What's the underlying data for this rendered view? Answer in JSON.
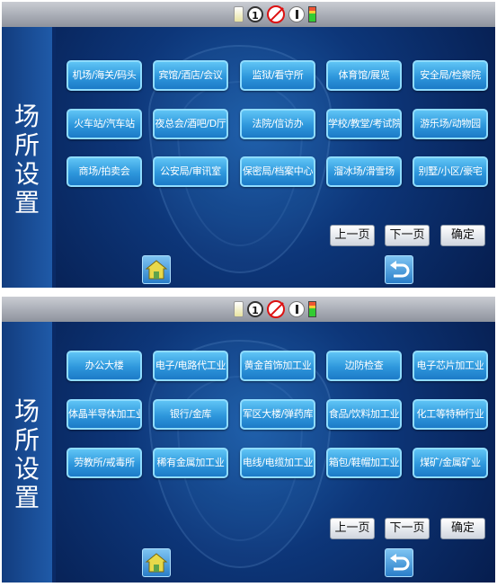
{
  "status_icons": [
    "flashlight-icon",
    "sim1-icon",
    "no-call-icon",
    "volume-icon",
    "battery-icon"
  ],
  "sim_label": "1",
  "sidebar_title": "场所设置",
  "nav": {
    "prev": "上一页",
    "next": "下一页",
    "confirm": "确定"
  },
  "screens": [
    {
      "buttons": [
        "机场/海关/码头",
        "宾馆/酒店/会议",
        "监狱/看守所",
        "体育馆/展览",
        "安全局/检察院",
        "火车站/汽车站",
        "夜总会/酒吧/D厅",
        "法院/信访办",
        "学校/教堂/考试院",
        "游乐场/动物园",
        "商场/拍卖会",
        "公安局/审讯室",
        "保密局/档案中心",
        "溜冰场/滑雪场",
        "别墅/小区/豪宅"
      ]
    },
    {
      "buttons": [
        "办公大楼",
        "电子/电路代工业",
        "黄金首饰加工业",
        "边防检查",
        "电子芯片加工业",
        "体晶半导体加工业",
        "银行/金库",
        "军区大楼/弹药库",
        "食品/饮料加工业",
        "化工等特种行业",
        "劳教所/戒毒所",
        "稀有金属加工业",
        "电线/电缆加工业",
        "箱包/鞋帽加工业",
        "煤矿/金属矿业"
      ]
    }
  ],
  "colors": {
    "button_top": "#5fc4f5",
    "button_bottom": "#1c7ac7",
    "background": "#0a2a66"
  }
}
